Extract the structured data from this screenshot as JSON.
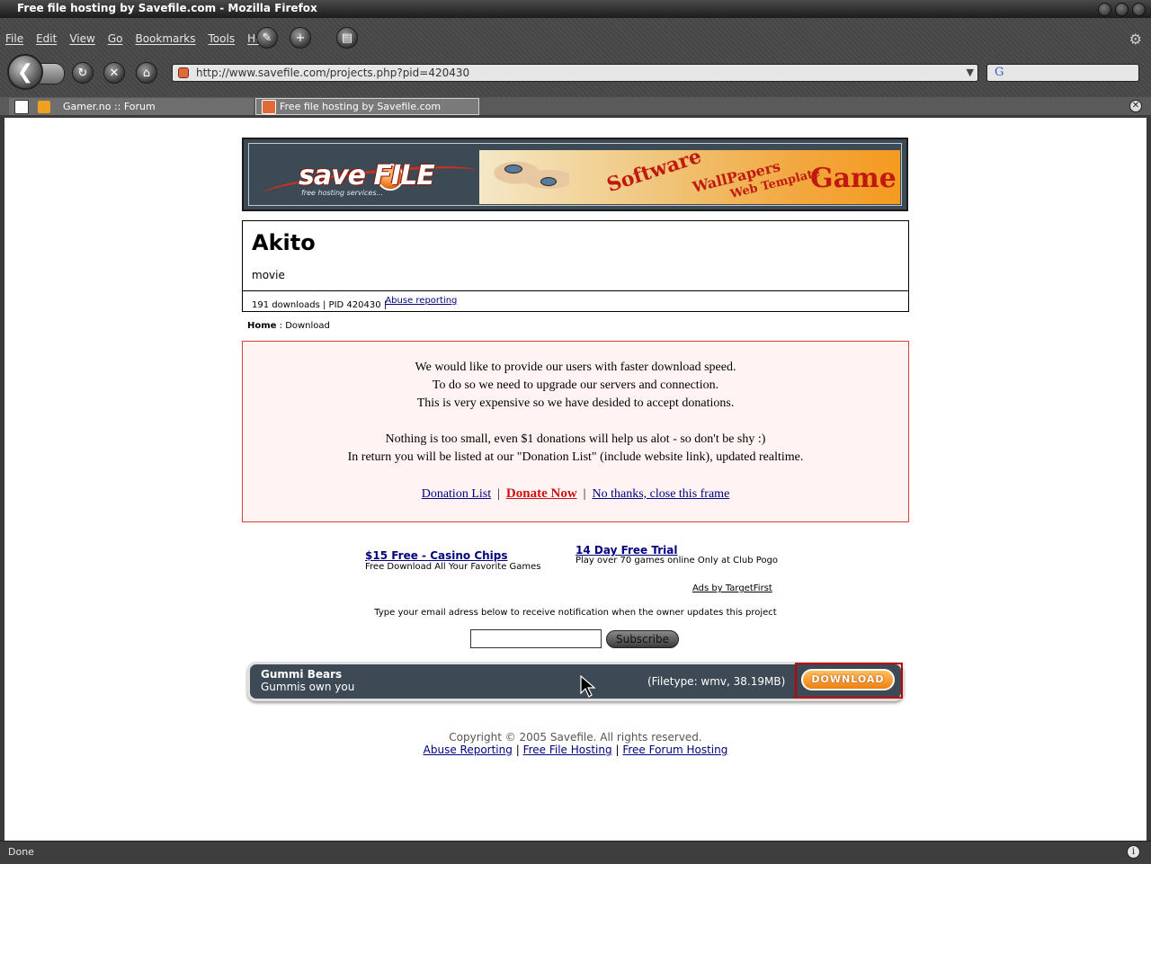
{
  "window": {
    "title": "Free file hosting by Savefile.com - Mozilla Firefox"
  },
  "menu": [
    "File",
    "Edit",
    "View",
    "Go",
    "Bookmarks",
    "Tools",
    "Help"
  ],
  "toolbar": {
    "url": "http://www.savefile.com/projects.php?pid=420430"
  },
  "tabs": [
    {
      "label": "Gamer.no :: Forum",
      "active": false
    },
    {
      "label": "Free file hosting by Savefile.com",
      "active": true
    }
  ],
  "banner": {
    "logo_word": "save FILE",
    "logo_sub": "free hosting services...",
    "ad_words": [
      "Software",
      "WallPapers",
      "Web Template",
      "Game"
    ]
  },
  "project": {
    "title": "Akito",
    "description": "movie",
    "stats": "191 downloads | PID 420430 |",
    "abuse_link": "Abuse reporting"
  },
  "breadcrumb": {
    "home": "Home",
    "sep": " : ",
    "current": "Download"
  },
  "donation": {
    "lines": [
      "We would like to provide our users with faster download speed.",
      "To do so we need to upgrade our servers and connection.",
      "This is very expensive so we have desided to accept donations.",
      "Nothing is too small, even $1 donations will help us alot - so don't be shy :)",
      "In return you will be listed at our \"Donation List\" (include website link), updated realtime."
    ],
    "link_list": "Donation List",
    "link_donate": "Donate Now",
    "link_close": "No thanks, close this frame",
    "sep": "|"
  },
  "ads": {
    "ad1_title": "$15 Free - Casino Chips",
    "ad1_desc": "Free Download All Your Favorite Games",
    "ad2_title": "14 Day Free Trial",
    "ad2_desc": "Play over 70 games online Only at Club Pogo",
    "ads_by": "Ads by TargetFirst"
  },
  "notify": {
    "text": "Type your email adress below to receive notification when the owner updates this project",
    "email_value": "",
    "subscribe_label": "Subscribe"
  },
  "download": {
    "name": "Gummi Bears",
    "subtitle": "Gummis own you",
    "info": "(Filetype: wmv, 38.19MB)",
    "button_label": "DOWNLOAD"
  },
  "footer": {
    "copyright": "Copyright © 2005 Savefile. All rights reserved.",
    "links": [
      "Abuse Reporting",
      "Free File Hosting",
      "Free Forum Hosting"
    ],
    "sep": "|"
  },
  "status": {
    "text": "Done"
  },
  "colors": {
    "donation_bg": "#fff3f3",
    "donation_border": "#d04040",
    "banner_bg": "#3c4a55",
    "download_button": "#f08010",
    "link": "#000080"
  }
}
